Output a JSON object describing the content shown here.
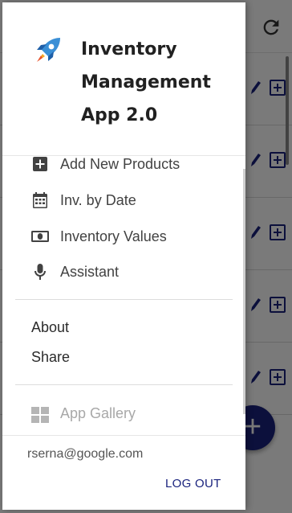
{
  "drawer": {
    "app_title": "Inventory Management App 2.0",
    "menu": [
      {
        "label": "Add New Products",
        "icon": "add-box-icon"
      },
      {
        "label": "Inv. by Date",
        "icon": "calendar-icon"
      },
      {
        "label": "Inventory Values",
        "icon": "money-icon"
      },
      {
        "label": "Assistant",
        "icon": "microphone-icon"
      }
    ],
    "secondary": [
      {
        "label": "About"
      },
      {
        "label": "Share"
      }
    ],
    "gallery": {
      "label": "App Gallery",
      "icon": "grid-icon"
    },
    "footer": {
      "email": "rserna@google.com",
      "logout_label": "LOG OUT"
    }
  },
  "colors": {
    "accent": "#1a237e",
    "scrim": "rgba(0,0,0,0.52)",
    "disabled_text": "#a8a8a8"
  },
  "background_app": {
    "fab_label": "+"
  }
}
